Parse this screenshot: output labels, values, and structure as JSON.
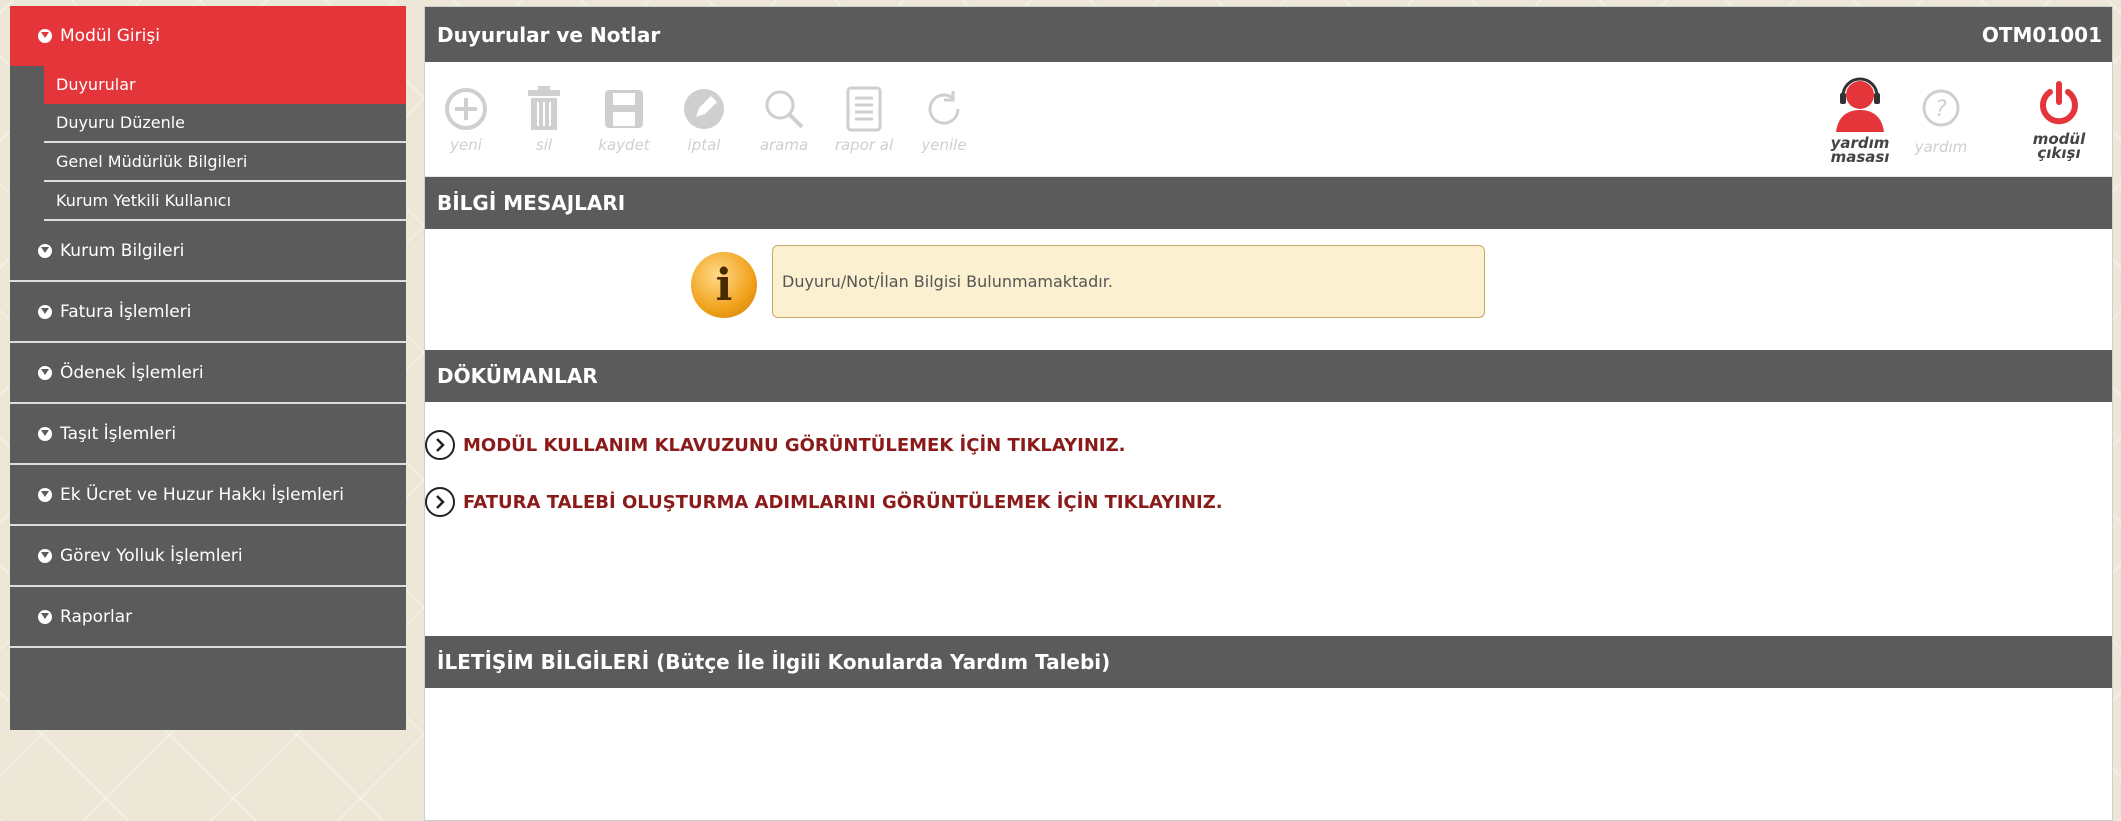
{
  "sidebar": {
    "active_menu": "Modül Girişi",
    "submenu": [
      "Duyurular",
      "Duyuru Düzenle",
      "Genel Müdürlük Bilgileri",
      "Kurum Yetkili Kullanıcı"
    ],
    "menus": [
      "Kurum Bilgileri",
      "Fatura İşlemleri",
      "Ödenek İşlemleri",
      "Taşıt İşlemleri",
      "Ek Ücret ve Huzur Hakkı İşlemleri",
      "Görev Yolluk İşlemleri",
      "Raporlar"
    ]
  },
  "header": {
    "title": "Duyurular ve Notlar",
    "code": "OTM01001"
  },
  "toolbar": {
    "yeni": "yeni",
    "sil": "sil",
    "kaydet": "kaydet",
    "iptal": "iptal",
    "arama": "arama",
    "rapor_al": "rapor al",
    "yenile": "yenile",
    "yardim_masasi_1": "yardım",
    "yardim_masasi_2": "masası",
    "yardim": "yardım",
    "modul_cikisi_1": "modül",
    "modul_cikisi_2": "çıkışı"
  },
  "sections": {
    "bilgi": "BİLGİ MESAJLARI",
    "info_message": "Duyuru/Not/İlan Bilgisi Bulunmamaktadır.",
    "dokumanlar": "DÖKÜMANLAR",
    "doc_links": [
      "MODÜL KULLANIM KLAVUZUNU GÖRÜNTÜLEMEK İÇİN TIKLAYINIZ.",
      "FATURA TALEBİ OLUŞTURMA ADIMLARINI GÖRÜNTÜLEMEK İÇİN TIKLAYINIZ."
    ],
    "iletisim": "İLETİŞİM BİLGİLERİ (Bütçe İle İlgili Konularda Yardım Talebi)"
  },
  "colors": {
    "accent_red": "#e4353a",
    "dark_gray": "#5b5b5b",
    "link_red": "#8b1a1a"
  }
}
